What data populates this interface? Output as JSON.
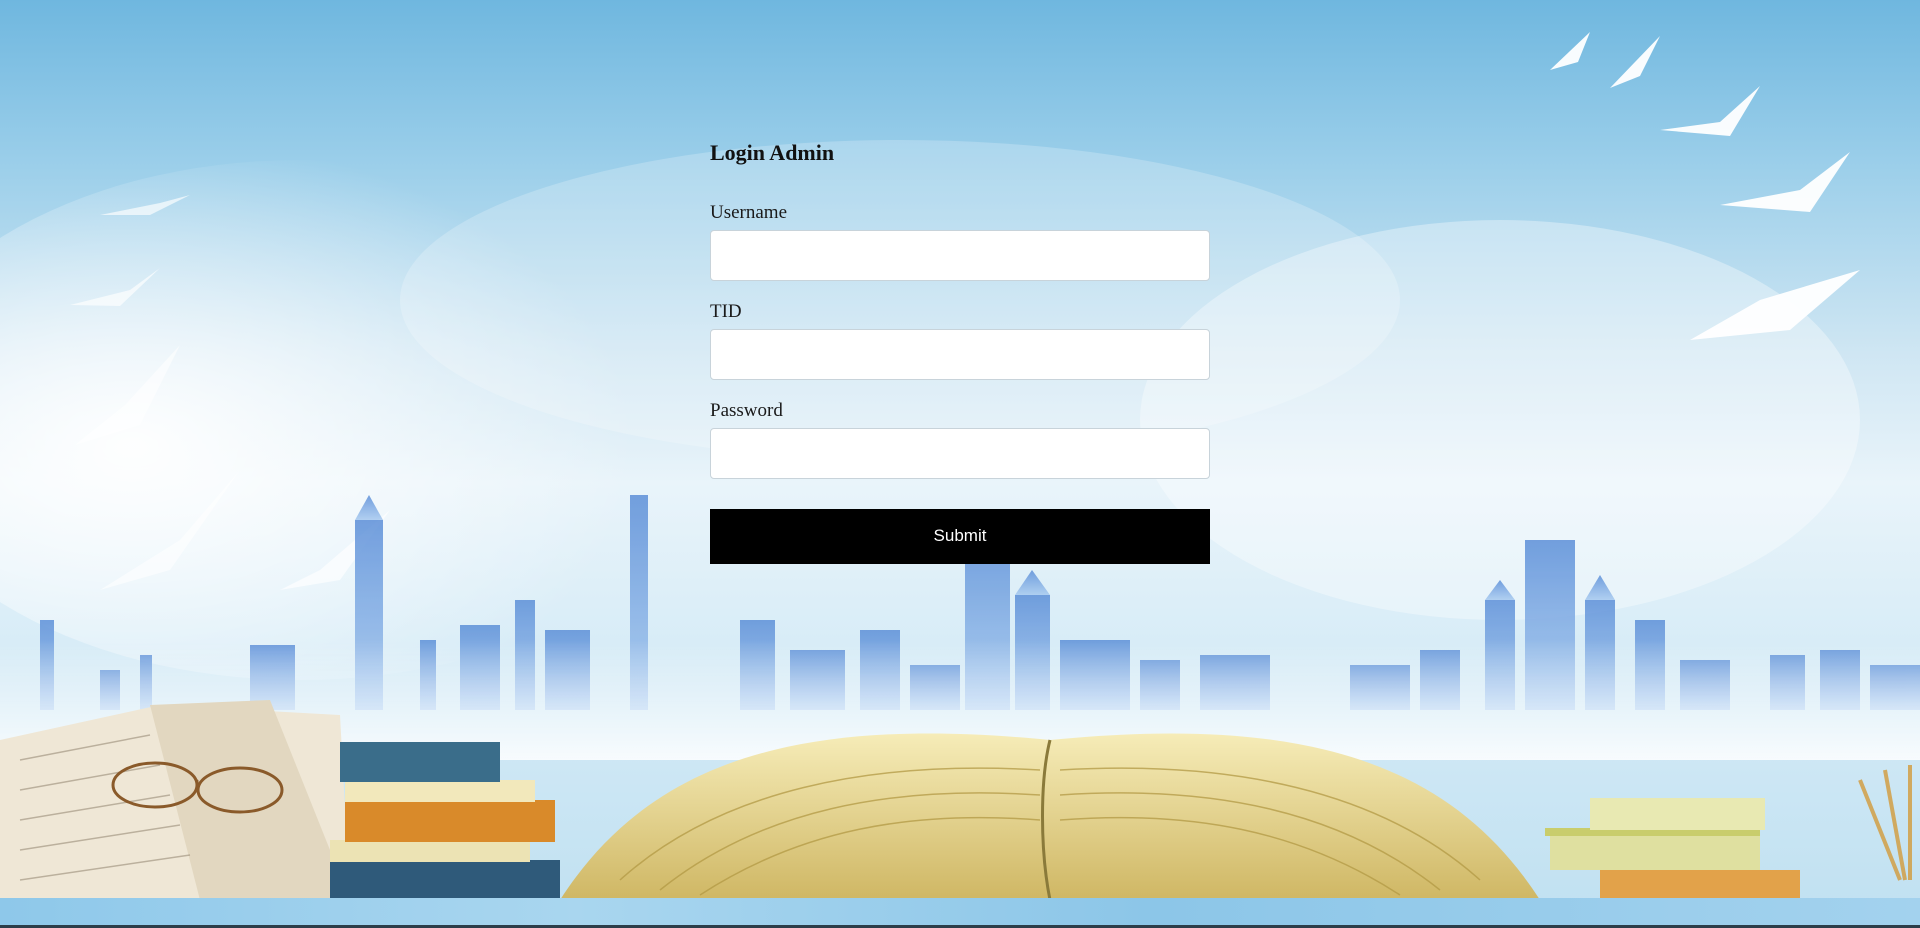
{
  "form": {
    "title": "Login Admin",
    "username": {
      "label": "Username",
      "value": "",
      "placeholder": ""
    },
    "tid": {
      "label": "TID",
      "value": "",
      "placeholder": ""
    },
    "password": {
      "label": "Password",
      "value": "",
      "placeholder": ""
    },
    "submit_label": "Submit"
  },
  "colors": {
    "button_bg": "#000000",
    "button_text": "#ffffff",
    "sky": "#9ccfea",
    "city": "#4b7fd0",
    "book_pages": "#e9d98a"
  }
}
